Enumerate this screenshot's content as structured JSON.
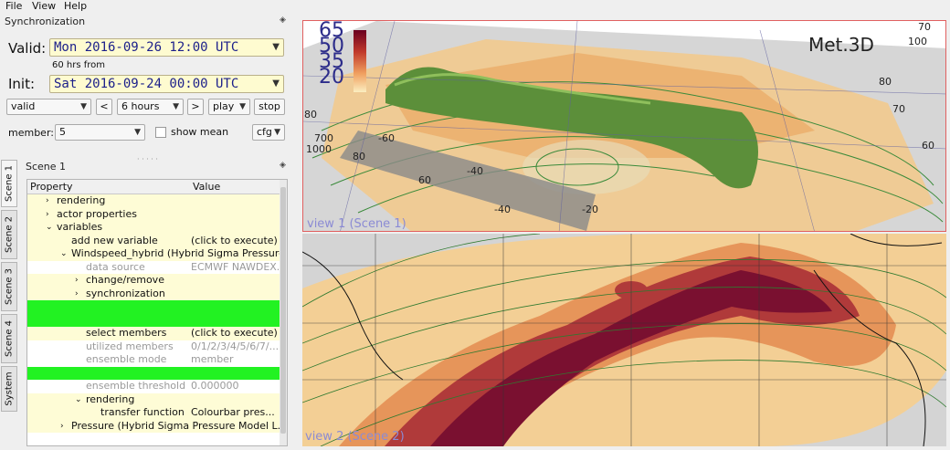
{
  "menu": {
    "file": "File",
    "view": "View",
    "help": "Help"
  },
  "sync": {
    "title": "Synchronization",
    "valid_label": "Valid:",
    "valid_value": "Mon 2016-09-26 12:00 UTC",
    "hrs_from": "60 hrs from",
    "init_label": "Init:",
    "init_value": "Sat 2016-09-24 00:00 UTC",
    "mode_value": "valid",
    "step_value": "6 hours",
    "play_label": "play",
    "stop_label": "stop",
    "member_label": "member:",
    "member_value": "5",
    "show_mean_label": "show mean",
    "cfg_label": "cfg",
    "prev_label": "<",
    "next_label": ">"
  },
  "scene": {
    "title": "Scene 1",
    "tabs": [
      "Scene 1",
      "Scene 2",
      "Scene 3",
      "Scene 4",
      "System"
    ],
    "columns": {
      "property": "Property",
      "value": "Value"
    },
    "rows": [
      {
        "indent": 0,
        "arrow": ">",
        "label": "rendering",
        "value": "",
        "style": "yellow"
      },
      {
        "indent": 0,
        "arrow": ">",
        "label": "actor properties",
        "value": "",
        "style": "yellow"
      },
      {
        "indent": 0,
        "arrow": "v",
        "label": "variables",
        "value": "",
        "style": "yellow"
      },
      {
        "indent": 1,
        "arrow": "",
        "label": "add new variable",
        "value": "(click to execute)",
        "style": "yellow"
      },
      {
        "indent": 1,
        "arrow": "v",
        "label": "Windspeed_hybrid (Hybrid Sigma Pressure Model L...",
        "value": "",
        "style": "yellow"
      },
      {
        "indent": 2,
        "arrow": "",
        "label": "data source",
        "value": "ECMWF NAWDEX...",
        "style": "grey"
      },
      {
        "indent": 2,
        "arrow": ">",
        "label": "change/remove",
        "value": "",
        "style": "yellow"
      },
      {
        "indent": 2,
        "arrow": ">",
        "label": "synchronization",
        "value": "",
        "style": "yellow"
      },
      {
        "indent": 2,
        "arrow": "",
        "label": "",
        "value": "",
        "style": "green"
      },
      {
        "indent": 2,
        "arrow": "",
        "label": "",
        "value": "",
        "style": "green"
      },
      {
        "indent": 2,
        "arrow": "",
        "label": "select members",
        "value": "(click to execute)",
        "style": "yellow"
      },
      {
        "indent": 2,
        "arrow": "",
        "label": "utilized members",
        "value": "0/1/2/3/4/5/6/7/...",
        "style": "grey"
      },
      {
        "indent": 2,
        "arrow": "",
        "label": "ensemble mode",
        "value": "member",
        "style": "grey"
      },
      {
        "indent": 2,
        "arrow": "",
        "label": "",
        "value": "",
        "style": "green"
      },
      {
        "indent": 2,
        "arrow": "",
        "label": "ensemble threshold",
        "value": "0.000000",
        "style": "grey"
      },
      {
        "indent": 2,
        "arrow": "v",
        "label": "rendering",
        "value": "",
        "style": "yellow"
      },
      {
        "indent": 3,
        "arrow": "",
        "label": "transfer function",
        "value": "Colourbar pres...",
        "style": "yellow"
      },
      {
        "indent": 1,
        "arrow": ">",
        "label": "Pressure (Hybrid Sigma Pressure Model L...",
        "value": "",
        "style": "yellow"
      }
    ]
  },
  "view1": {
    "label": "view 1 (Scene 1)",
    "logo": "Met.3D",
    "colorbar_ticks": [
      "65",
      "50",
      "35",
      "20"
    ],
    "axis_labels": [
      "70",
      "100",
      "80",
      "70",
      "60",
      "80",
      "700",
      "1000",
      "80",
      "-60",
      "-40",
      "60",
      "-40",
      "-20"
    ]
  },
  "view2": {
    "label": "view 2 (Scene 2)"
  },
  "colors": {
    "accent_border": "#e06060",
    "combo_text": "#1b1f8a",
    "highlight_green": "#22f222",
    "row_yellow": "#fefcd6"
  }
}
